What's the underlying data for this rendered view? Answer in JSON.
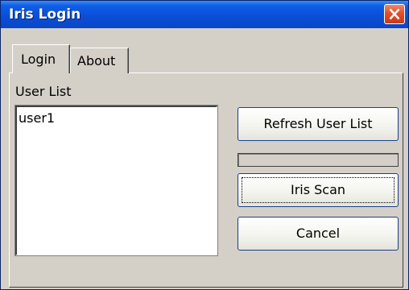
{
  "window": {
    "title": "Iris Login"
  },
  "tabs": [
    {
      "label": "Login",
      "selected": true
    },
    {
      "label": "About",
      "selected": false
    }
  ],
  "login_panel": {
    "user_list_label": "User List",
    "users": [
      "user1"
    ],
    "buttons": {
      "refresh": "Refresh User List",
      "iris_scan": "Iris Scan",
      "cancel": "Cancel"
    },
    "scan_progress": 0
  },
  "colors": {
    "titlebar": "#0a4fd8",
    "close_button": "#e0502c",
    "window_face": "#d4d0c8"
  },
  "icons": {
    "close": "close-icon"
  }
}
